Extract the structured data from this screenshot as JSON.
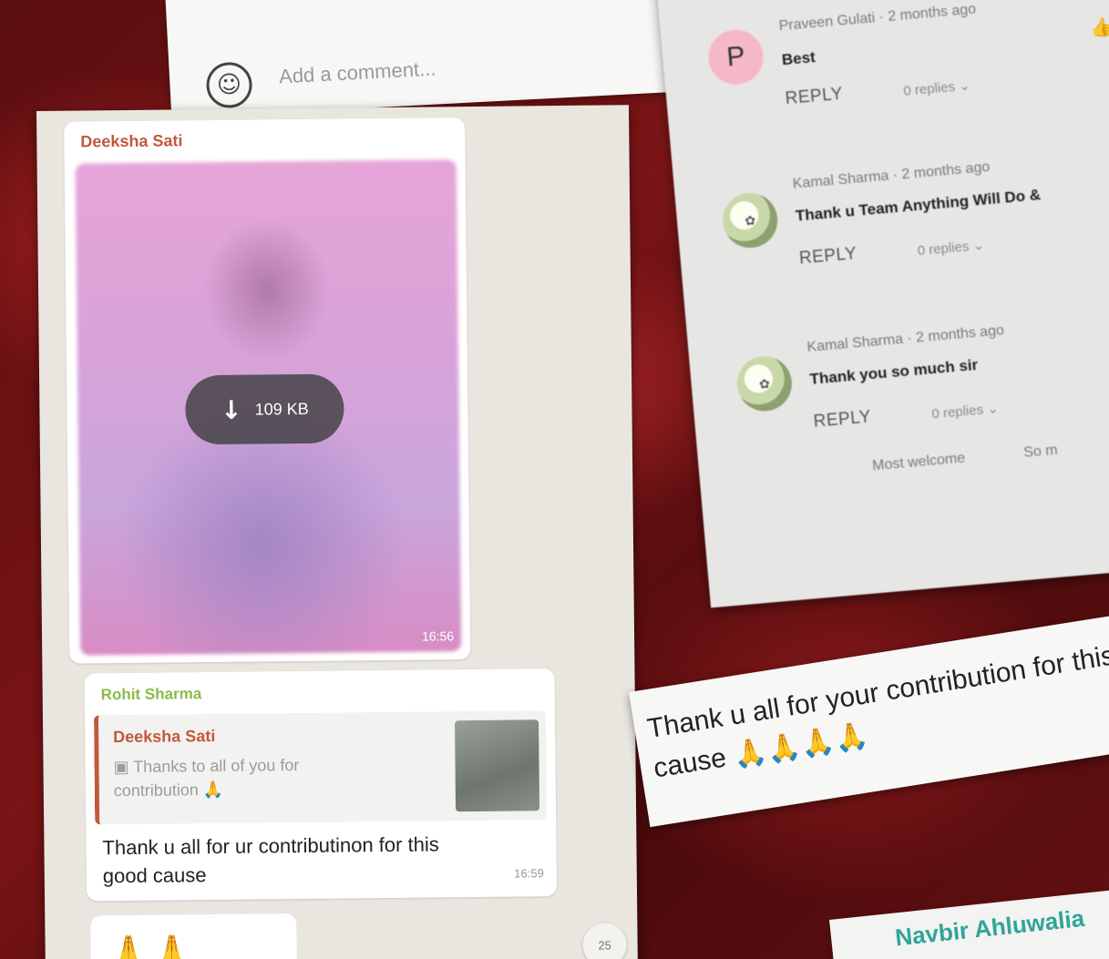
{
  "composer": {
    "placeholder": "Add a comment...",
    "emoji_icon": "smiley-face-icon"
  },
  "comments": [
    {
      "avatar_letter": "P",
      "author": "Praveen Gulati",
      "time": "2 months ago",
      "text": "Best",
      "reply_label": "REPLY",
      "replies": "0 replies",
      "icon": "thumbs-up-icon"
    },
    {
      "author": "Kamal Sharma",
      "time": "2 months ago",
      "text": "Thank u Team Anything Will Do &",
      "reply_label": "REPLY",
      "replies": "0 replies"
    },
    {
      "author": "Kamal Sharma",
      "time": "2 months ago",
      "text": "Thank you so much sir",
      "reply_label": "REPLY",
      "replies": "0 replies",
      "suggestions": [
        "Most welcome",
        "So m"
      ]
    }
  ],
  "chat": {
    "image_message": {
      "sender": "Deeksha Sati",
      "download_size": "109 KB",
      "time": "16:56",
      "sender_color": "#c2583e"
    },
    "reply_message": {
      "sender": "Rohit Sharma",
      "sender_color": "#8cb94b",
      "quoted_sender": "Deeksha Sati",
      "quoted_text": "Thanks to all of you for contribution 🙏",
      "text": "Thank u all for ur contributinon for this good cause",
      "time": "16:59"
    },
    "emoji_message": {
      "text": "🙏🙏"
    },
    "scroll_badge": "25"
  },
  "caption": {
    "text": "Thank u all for your contribution for this good cause",
    "emoji": "🙏🙏🙏🙏"
  },
  "namecard": {
    "name": "Navbir Ahluwalia"
  }
}
